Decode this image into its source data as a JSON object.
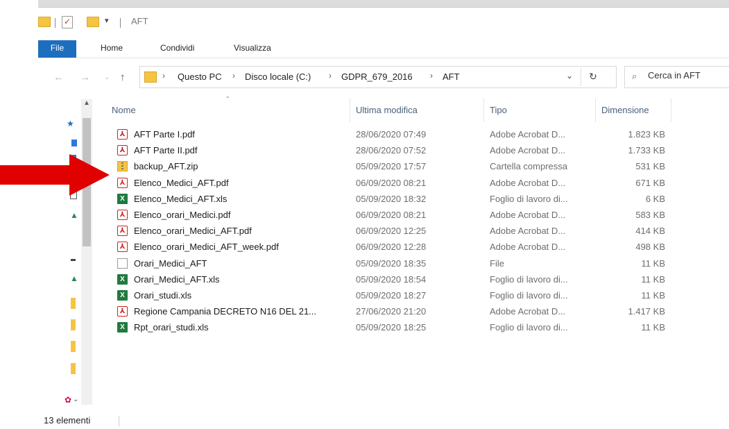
{
  "window": {
    "title": "AFT"
  },
  "ribbon": {
    "tabs": [
      {
        "label": "File"
      },
      {
        "label": "Home"
      },
      {
        "label": "Condividi"
      },
      {
        "label": "Visualizza"
      }
    ]
  },
  "address": {
    "crumbs": [
      "Questo PC",
      "Disco locale (C:)",
      "GDPR_679_2016",
      "AFT"
    ]
  },
  "search": {
    "placeholder": "Cerca in AFT"
  },
  "columns": {
    "name": "Nome",
    "modified": "Ultima modifica",
    "type": "Tipo",
    "size": "Dimensione"
  },
  "files": [
    {
      "name": "AFT Parte I.pdf",
      "modified": "28/06/2020 07:49",
      "type": "Adobe Acrobat D...",
      "size": "1.823 KB",
      "icon": "pdf-icon"
    },
    {
      "name": "AFT Parte II.pdf",
      "modified": "28/06/2020 07:52",
      "type": "Adobe Acrobat D...",
      "size": "1.733 KB",
      "icon": "pdf-icon"
    },
    {
      "name": "backup_AFT.zip",
      "modified": "05/09/2020 17:57",
      "type": "Cartella compressa",
      "size": "531 KB",
      "icon": "zip-icon"
    },
    {
      "name": "Elenco_Medici_AFT.pdf",
      "modified": "06/09/2020 08:21",
      "type": "Adobe Acrobat D...",
      "size": "671 KB",
      "icon": "pdf-icon"
    },
    {
      "name": "Elenco_Medici_AFT.xls",
      "modified": "05/09/2020 18:32",
      "type": "Foglio di lavoro di...",
      "size": "6 KB",
      "icon": "xls-icon"
    },
    {
      "name": "Elenco_orari_Medici.pdf",
      "modified": "06/09/2020 08:21",
      "type": "Adobe Acrobat D...",
      "size": "583 KB",
      "icon": "pdf-icon"
    },
    {
      "name": "Elenco_orari_Medici_AFT.pdf",
      "modified": "06/09/2020 12:25",
      "type": "Adobe Acrobat D...",
      "size": "414 KB",
      "icon": "pdf-icon"
    },
    {
      "name": "Elenco_orari_Medici_AFT_week.pdf",
      "modified": "06/09/2020 12:28",
      "type": "Adobe Acrobat D...",
      "size": "498 KB",
      "icon": "pdf-icon"
    },
    {
      "name": "Orari_Medici_AFT",
      "modified": "05/09/2020 18:35",
      "type": "File",
      "size": "11 KB",
      "icon": "file-icon"
    },
    {
      "name": "Orari_Medici_AFT.xls",
      "modified": "05/09/2020 18:54",
      "type": "Foglio di lavoro di...",
      "size": "11 KB",
      "icon": "xls-icon"
    },
    {
      "name": "Orari_studi.xls",
      "modified": "05/09/2020 18:27",
      "type": "Foglio di lavoro di...",
      "size": "11 KB",
      "icon": "xls-icon"
    },
    {
      "name": "Regione Campania DECRETO N16 DEL 21...",
      "modified": "27/06/2020 21:20",
      "type": "Adobe Acrobat D...",
      "size": "1.417 KB",
      "icon": "pdf-icon"
    },
    {
      "name": "Rpt_orari_studi.xls",
      "modified": "05/09/2020 18:25",
      "type": "Foglio di lavoro di...",
      "size": "11 KB",
      "icon": "xls-icon"
    }
  ],
  "status": {
    "count": "13 elementi"
  },
  "colors": {
    "accent": "#1e6ebf",
    "annotation_arrow": "#e00000",
    "pdf": "#cc2222",
    "xls": "#1f7a3f",
    "folder": "#f5c542"
  }
}
